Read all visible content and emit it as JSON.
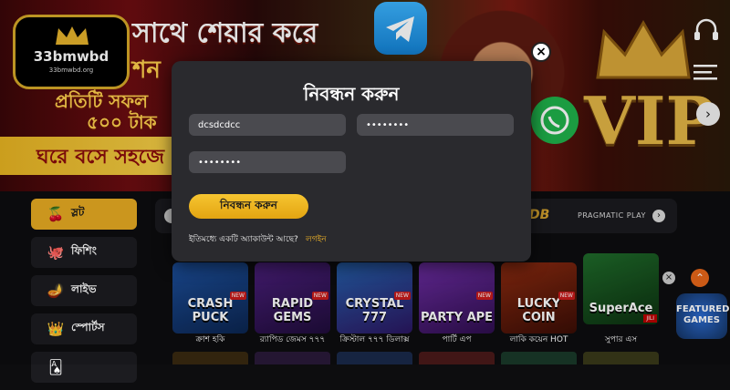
{
  "banner": {
    "line1": "সাথে শেয়ার করে",
    "line2": "শন",
    "line3": "প্রতিটি সফল",
    "line4": "৫০০ টাক",
    "line5": "ঘরে বসে সহজে",
    "vip": "VIP"
  },
  "logo": {
    "main": "33bmwbd",
    "sub": "33bmwbd.org"
  },
  "sidebar": {
    "items": [
      {
        "label": "স্লট",
        "icon": "cherry-icon",
        "active": true
      },
      {
        "label": "ফিশিং",
        "icon": "octopus-icon",
        "active": false
      },
      {
        "label": "লাইভ",
        "icon": "genie-lamp-icon",
        "active": false
      },
      {
        "label": "স্পোর্টস",
        "icon": "crown-icon",
        "active": false
      },
      {
        "label": "",
        "icon": "cards-icon",
        "active": false
      }
    ]
  },
  "providers": {
    "db": "DB",
    "pp": "PRAGMATIC PLAY"
  },
  "games": [
    {
      "title": "ক্রাশ হকি",
      "tile_text": "CRASH PUCK",
      "badge": "NEW",
      "color": "#1c4e9a"
    },
    {
      "title": "র‍্যাপিড জেমস ৭৭৭",
      "tile_text": "RAPID GEMS",
      "badge": "NEW",
      "color": "#4a1f7a"
    },
    {
      "title": "ক্রিস্টাল ৭৭৭ ডিলাক্স",
      "tile_text": "CRYSTAL 777",
      "badge": "NEW",
      "color": "#245ea8"
    },
    {
      "title": "পার্টি এপ",
      "tile_text": "PARTY APE",
      "badge": "NEW",
      "color": "#6b2ca0"
    },
    {
      "title": "লাকি কয়েন HOT",
      "tile_text": "LUCKY COIN",
      "badge": "NEW",
      "color": "#8a2a10"
    },
    {
      "title": "সুপার এস",
      "tile_text": "SuperAce",
      "badge": "JILI",
      "color": "#1f6b2a"
    }
  ],
  "featured": "FEATURED GAMES",
  "modal": {
    "title": "নিবন্ধন করুন",
    "username_value": "dcsdcdcc",
    "password_value": "••••••••",
    "confirm_value": "••••••••",
    "submit_label": "নিবন্ধন করুন",
    "have_account": "ইতিমধ্যে একটি অ্যাকাউন্ট আছে?",
    "login_label": "লগইন",
    "close_symbol": "×"
  },
  "colors": {
    "accent": "#e8ab23",
    "modal_bg": "#2a2a2e",
    "field_bg": "#4a4a4f",
    "link": "#f0b429"
  }
}
